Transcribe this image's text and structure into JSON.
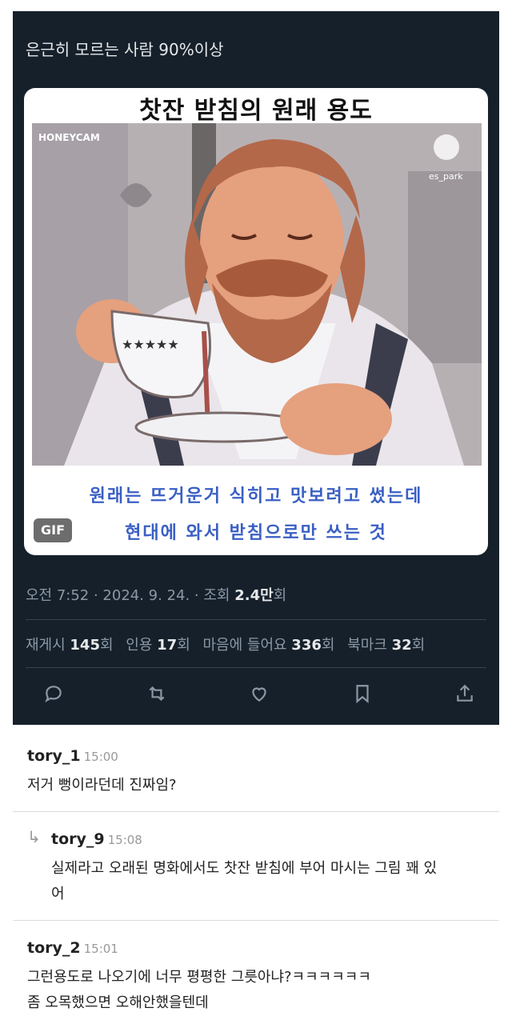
{
  "tweet": {
    "text": "은근히 모르는 사람 90%이상",
    "media": {
      "title": "찻잔 받침의 원래 용도",
      "watermark_left": "HONEYCAM",
      "watermark_right": "es_park",
      "caption_line1": "원래는 뜨거운거 식히고 맛보려고 썼는데",
      "caption_line2": "현대에 와서 받침으로만 쓰는 것",
      "badge": "GIF"
    },
    "meta": {
      "time": "오전 7:52 · 2024. 9. 24. · 조회 ",
      "views": "2.4만",
      "views_unit": "회"
    },
    "stats": {
      "retweets_label": "재게시 ",
      "retweets": "145",
      "retweets_unit": "회",
      "quotes_label": "인용 ",
      "quotes": "17",
      "quotes_unit": "회",
      "likes_label": "마음에 들어요 ",
      "likes": "336",
      "likes_unit": "회",
      "bookmarks_label": "북마크 ",
      "bookmarks": "32",
      "bookmarks_unit": "회"
    },
    "actions": [
      "reply-icon",
      "retweet-icon",
      "like-icon",
      "bookmark-icon",
      "share-icon"
    ]
  },
  "comments": [
    {
      "user": "tory_1",
      "time": "15:00",
      "text": "저거 뻥이라던데 진짜임?"
    },
    {
      "user": "tory_9",
      "time": "15:08",
      "text_line1": "실제라고 오래된 명화에서도 찻잔 받침에 부어 마시는 그림 꽤 있",
      "text_line2": "어",
      "reply": true
    },
    {
      "user": "tory_2",
      "time": "15:01",
      "text_line1": "그런용도로 나오기에 너무 평평한 그릇아냐?ㅋㅋㅋㅋㅋㅋ",
      "text_line2": "좀 오목했으면 오해안했을텐데"
    }
  ]
}
